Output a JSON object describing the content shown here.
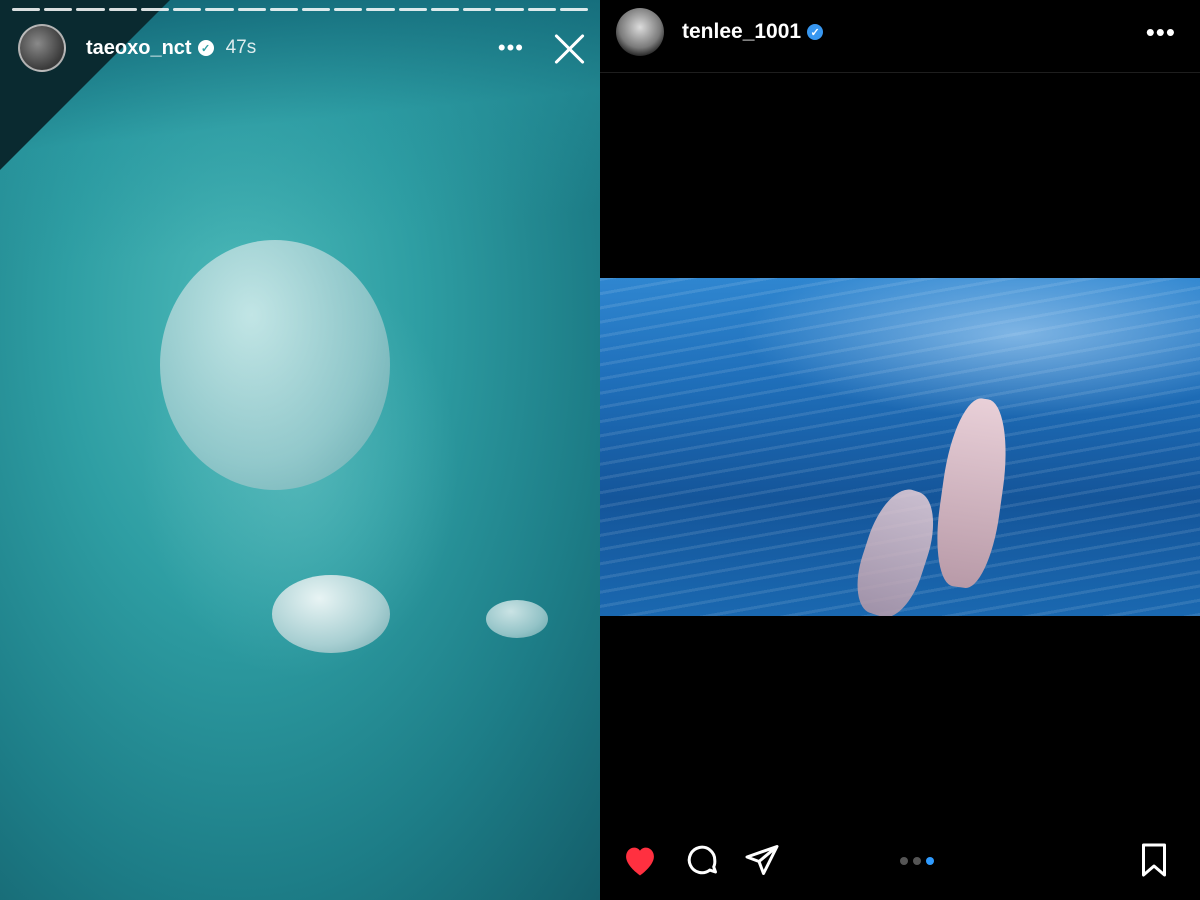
{
  "story": {
    "username": "taeoxo_nct",
    "timestamp": "47s",
    "more_icon": "more-horizontal-icon",
    "close_icon": "close-icon",
    "progress_segments": 18
  },
  "post": {
    "username": "tenlee_1001",
    "more_icon": "more-horizontal-icon",
    "liked": true,
    "actions": [
      "heart-icon",
      "comment-icon",
      "share-icon",
      "bookmark-icon"
    ],
    "carousel": {
      "count": 3,
      "active_index": 2
    }
  },
  "colors": {
    "like_red": "#ff3040",
    "verified_blue": "#3897f0",
    "carousel_active": "#2f9bff"
  }
}
